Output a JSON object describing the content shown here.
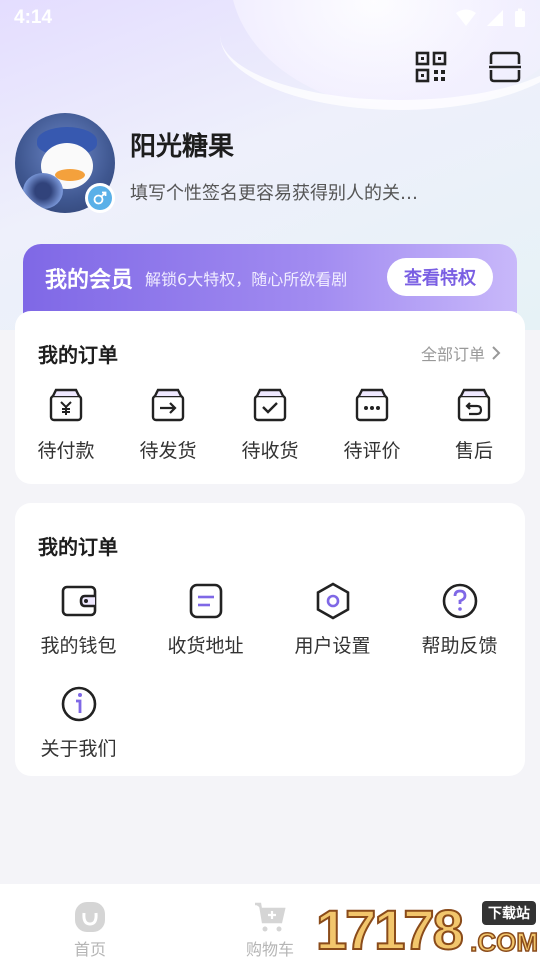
{
  "status_bar": {
    "time": "4:14"
  },
  "profile": {
    "username": "阳光糖果",
    "signature": "填写个性签名更容易获得别人的关…"
  },
  "vip": {
    "title": "我的会员",
    "subtitle": "解锁6大特权，随心所欲看剧",
    "button": "查看特权"
  },
  "orders": {
    "title": "我的订单",
    "all_link": "全部订单",
    "items": [
      {
        "label": "待付款",
        "icon": "box-yen-icon"
      },
      {
        "label": "待发货",
        "icon": "box-arrow-icon"
      },
      {
        "label": "待收货",
        "icon": "box-check-icon"
      },
      {
        "label": "待评价",
        "icon": "box-dots-icon"
      },
      {
        "label": "售后",
        "icon": "box-return-icon"
      }
    ]
  },
  "services": {
    "title": "我的订单",
    "items": [
      {
        "label": "我的钱包",
        "icon": "wallet-icon"
      },
      {
        "label": "收货地址",
        "icon": "address-icon"
      },
      {
        "label": "用户设置",
        "icon": "settings-hexagon-icon"
      },
      {
        "label": "帮助反馈",
        "icon": "help-icon"
      },
      {
        "label": "关于我们",
        "icon": "info-icon"
      }
    ]
  },
  "tabbar": {
    "items": [
      {
        "label": "首页",
        "icon": "home-icon"
      },
      {
        "label": "购物车",
        "icon": "cart-icon"
      }
    ]
  },
  "watermark": {
    "digits": "17178",
    "tag": "下载站",
    "domain": ".COM"
  },
  "colors": {
    "accent": "#7f68e6",
    "icon_stroke": "#222222",
    "tab_inactive": "#b5b5b5"
  }
}
